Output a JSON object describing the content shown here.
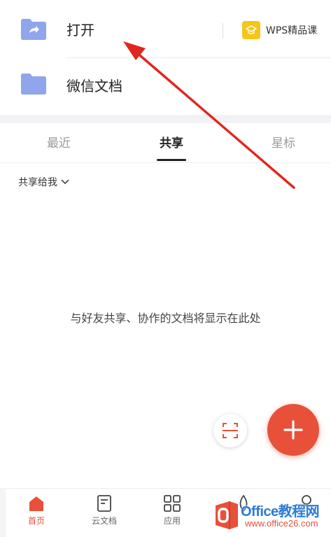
{
  "folders": {
    "open_label": "打开",
    "wechat_label": "微信文档"
  },
  "wps_course": {
    "label": "WPS精品课"
  },
  "tabs": {
    "recent": "最近",
    "share": "共享",
    "star": "星标"
  },
  "filter": {
    "label": "共享给我"
  },
  "empty_state": {
    "message": "与好友共享、协作的文档将显示在此处"
  },
  "bottom_nav": {
    "home": "首页",
    "cloud": "云文档",
    "apps": "应用",
    "other": "",
    "me": ""
  },
  "watermark": {
    "line1": "Office教程网",
    "line2": "www.office26.com"
  },
  "colors": {
    "accent": "#e8503a",
    "folder": "#8fa5ec",
    "wps_yellow": "#f5c518",
    "arrow": "#e0271f"
  }
}
